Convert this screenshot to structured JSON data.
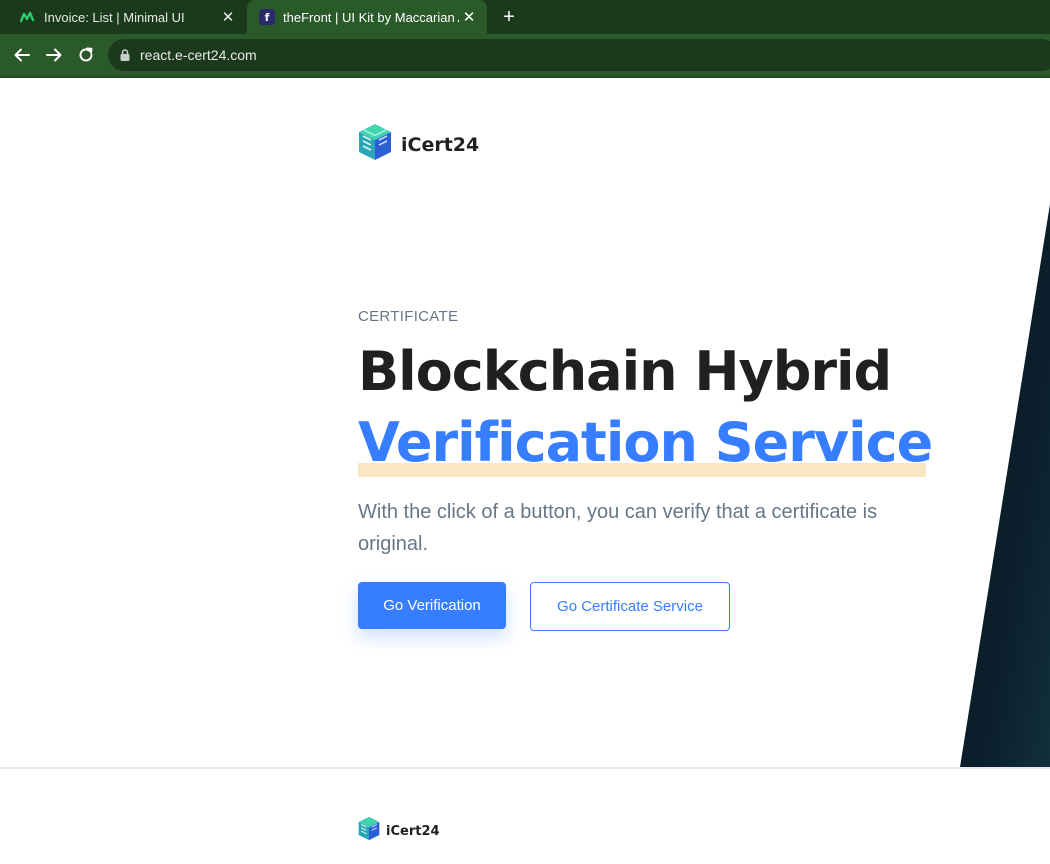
{
  "browser": {
    "tabs": [
      {
        "title": "Invoice: List | Minimal UI",
        "favicon": "minimal-logo-icon",
        "active": false,
        "close": "✕"
      },
      {
        "title": "theFront | UI Kit by Maccarian Agency",
        "favicon": "f-logo-icon",
        "favicon_letter": "f",
        "active": true,
        "close": "✕"
      }
    ],
    "new_tab": "+",
    "url": "react.e-cert24.com",
    "colors": {
      "tabstrip": "#1b3a1b",
      "toolbar": "#2a5a2a"
    }
  },
  "header": {
    "brand": "iCert24",
    "logo": "cube-logo-icon"
  },
  "hero": {
    "eyebrow": "CERTIFICATE",
    "title_line1": "Blockchain Hybrid",
    "title_line2": "Verification Service",
    "lead": "With the click of a button, you can verify that a certificate is original.",
    "primary_button": "Go Verification",
    "secondary_button": "Go Certificate Service",
    "colors": {
      "accent": "#377dff",
      "highlight": "#f9e7c2",
      "text": "#1e2022",
      "muted": "#677788"
    }
  },
  "footer": {
    "brand": "iCert24"
  }
}
